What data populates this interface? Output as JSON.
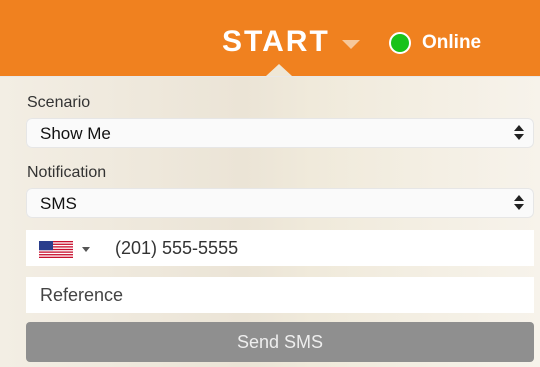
{
  "header": {
    "start_label": "START",
    "status_label": "Online",
    "colors": {
      "accent": "#f0811f",
      "status_online": "#18c21a"
    }
  },
  "form": {
    "scenario": {
      "label": "Scenario",
      "selected": "Show Me"
    },
    "notification": {
      "label": "Notification",
      "selected": "SMS"
    },
    "phone": {
      "country_icon": "us-flag-icon",
      "value": "(201) 555-5555"
    },
    "reference": {
      "placeholder": "Reference",
      "value": ""
    },
    "send_label": "Send SMS"
  }
}
